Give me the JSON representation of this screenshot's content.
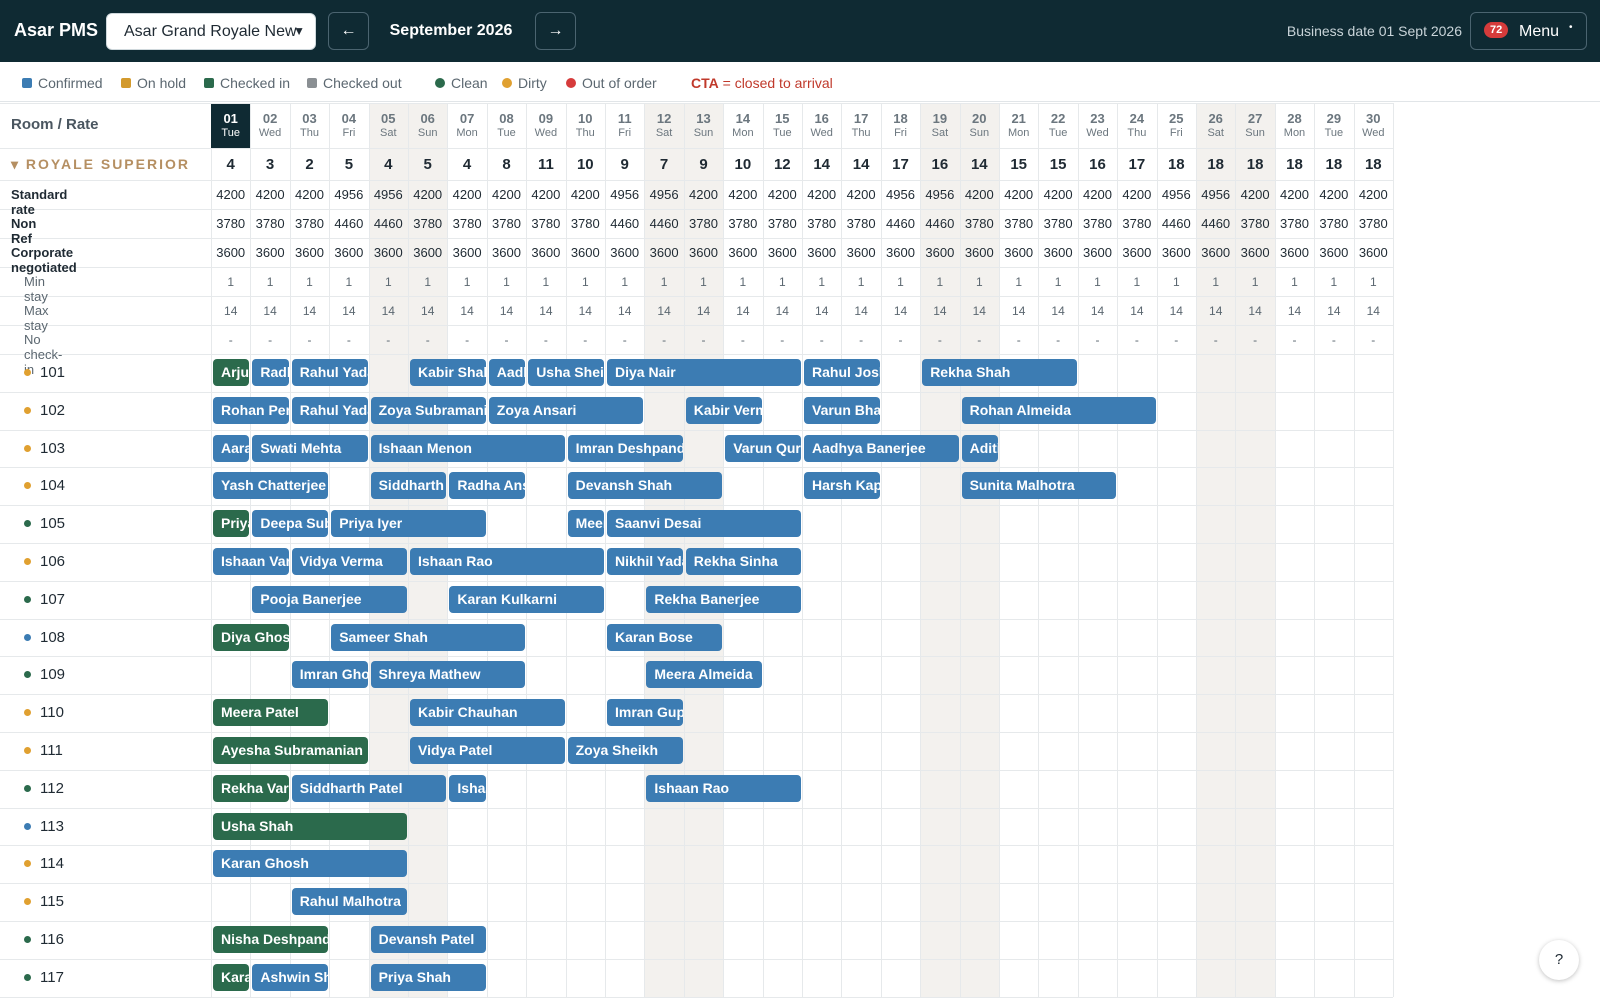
{
  "topbar": {
    "brand": "Asar PMS",
    "property": "Asar Grand Royale New",
    "prev_icon": "arrow-left-icon",
    "next_icon": "arrow-right-icon",
    "month": "September 2026",
    "business_date": "Business date 01 Sept 2026",
    "menu_badge": "72",
    "menu_label": "Menu"
  },
  "colors": {
    "topbar": "#0f2a33",
    "confirmed": "#3c7cb3",
    "on_hold": "#d39a2d",
    "checked_in": "#2b6a4c",
    "checked_out": "#8a8f93",
    "clean": "#2b6a4c",
    "dirty": "#e0a030",
    "out_of_order": "#d63b3b",
    "section": "#b58f62"
  },
  "legend": {
    "confirmed": "Confirmed",
    "on_hold": "On hold",
    "checked_in": "Checked in",
    "checked_out": "Checked out",
    "clean": "Clean",
    "dirty": "Dirty",
    "out_of_order": "Out of order",
    "cta_code": "CTA",
    "cta_text": " = closed to arrival"
  },
  "grid": {
    "room_rate_header": "Room / Rate",
    "section_title": "▾ ROYALE SUPERIOR",
    "days": [
      {
        "d": "01",
        "w": "Tue"
      },
      {
        "d": "02",
        "w": "Wed"
      },
      {
        "d": "03",
        "w": "Thu"
      },
      {
        "d": "04",
        "w": "Fri"
      },
      {
        "d": "05",
        "w": "Sat"
      },
      {
        "d": "06",
        "w": "Sun"
      },
      {
        "d": "07",
        "w": "Mon"
      },
      {
        "d": "08",
        "w": "Tue"
      },
      {
        "d": "09",
        "w": "Wed"
      },
      {
        "d": "10",
        "w": "Thu"
      },
      {
        "d": "11",
        "w": "Fri"
      },
      {
        "d": "12",
        "w": "Sat"
      },
      {
        "d": "13",
        "w": "Sun"
      },
      {
        "d": "14",
        "w": "Mon"
      },
      {
        "d": "15",
        "w": "Tue"
      },
      {
        "d": "16",
        "w": "Wed"
      },
      {
        "d": "17",
        "w": "Thu"
      },
      {
        "d": "18",
        "w": "Fri"
      },
      {
        "d": "19",
        "w": "Sat"
      },
      {
        "d": "20",
        "w": "Sun"
      },
      {
        "d": "21",
        "w": "Mon"
      },
      {
        "d": "22",
        "w": "Tue"
      },
      {
        "d": "23",
        "w": "Wed"
      },
      {
        "d": "24",
        "w": "Thu"
      },
      {
        "d": "25",
        "w": "Fri"
      },
      {
        "d": "26",
        "w": "Sat"
      },
      {
        "d": "27",
        "w": "Sun"
      },
      {
        "d": "28",
        "w": "Mon"
      },
      {
        "d": "29",
        "w": "Tue"
      },
      {
        "d": "30",
        "w": "Wed"
      }
    ],
    "availability": [
      4,
      3,
      2,
      5,
      4,
      5,
      4,
      8,
      11,
      10,
      9,
      7,
      9,
      10,
      12,
      14,
      14,
      17,
      16,
      14,
      15,
      15,
      16,
      17,
      18,
      18,
      18,
      18,
      18,
      18
    ],
    "rates": [
      {
        "label": "Standard rate",
        "values": [
          "4200",
          "4200",
          "4200",
          "4956",
          "4956",
          "4200",
          "4200",
          "4200",
          "4200",
          "4200",
          "4956",
          "4956",
          "4200",
          "4200",
          "4200",
          "4200",
          "4200",
          "4956",
          "4956",
          "4200",
          "4200",
          "4200",
          "4200",
          "4200",
          "4956",
          "4956",
          "4200",
          "4200",
          "4200",
          "4200"
        ]
      },
      {
        "label": "Non Ref",
        "values": [
          "3780",
          "3780",
          "3780",
          "4460",
          "4460",
          "3780",
          "3780",
          "3780",
          "3780",
          "3780",
          "4460",
          "4460",
          "3780",
          "3780",
          "3780",
          "3780",
          "3780",
          "4460",
          "4460",
          "3780",
          "3780",
          "3780",
          "3780",
          "3780",
          "4460",
          "4460",
          "3780",
          "3780",
          "3780",
          "3780"
        ]
      },
      {
        "label": "Corporate negotiated",
        "values": [
          "3600",
          "3600",
          "3600",
          "3600",
          "3600",
          "3600",
          "3600",
          "3600",
          "3600",
          "3600",
          "3600",
          "3600",
          "3600",
          "3600",
          "3600",
          "3600",
          "3600",
          "3600",
          "3600",
          "3600",
          "3600",
          "3600",
          "3600",
          "3600",
          "3600",
          "3600",
          "3600",
          "3600",
          "3600",
          "3600"
        ]
      }
    ],
    "restrictions": [
      {
        "label": "Min stay",
        "value": "1"
      },
      {
        "label": "Max stay",
        "value": "14"
      },
      {
        "label": "No check-in",
        "value": "-"
      }
    ],
    "rooms": [
      {
        "no": "101",
        "status": "dirty",
        "bookings": [
          {
            "n": "Arjun",
            "s": 0,
            "e": 1,
            "t": "cin"
          },
          {
            "n": "Radha",
            "s": 1,
            "e": 2,
            "t": "conf"
          },
          {
            "n": "Rahul Yadav",
            "s": 2,
            "e": 4,
            "t": "conf"
          },
          {
            "n": "Kabir Shah",
            "s": 5,
            "e": 7,
            "t": "conf"
          },
          {
            "n": "Aadhya",
            "s": 7,
            "e": 8,
            "t": "conf"
          },
          {
            "n": "Usha Sheikh",
            "s": 8,
            "e": 10,
            "t": "conf"
          },
          {
            "n": "Diya Nair",
            "s": 10,
            "e": 15,
            "t": "conf"
          },
          {
            "n": "Rahul Joshi",
            "s": 15,
            "e": 17,
            "t": "conf"
          },
          {
            "n": "Rekha Shah",
            "s": 18,
            "e": 22,
            "t": "conf"
          }
        ]
      },
      {
        "no": "102",
        "status": "dirty",
        "bookings": [
          {
            "n": "Rohan Pereira",
            "s": 0,
            "e": 2,
            "t": "conf"
          },
          {
            "n": "Rahul Yadav",
            "s": 2,
            "e": 4,
            "t": "conf"
          },
          {
            "n": "Zoya Subramanian",
            "s": 4,
            "e": 7,
            "t": "conf"
          },
          {
            "n": "Zoya Ansari",
            "s": 7,
            "e": 11,
            "t": "conf"
          },
          {
            "n": "Kabir Verma",
            "s": 12,
            "e": 14,
            "t": "conf"
          },
          {
            "n": "Varun Bhatt",
            "s": 15,
            "e": 17,
            "t": "conf"
          },
          {
            "n": "Rohan Almeida",
            "s": 19,
            "e": 24,
            "t": "conf"
          }
        ]
      },
      {
        "no": "103",
        "status": "dirty",
        "bookings": [
          {
            "n": "Aarav",
            "s": 0,
            "e": 1,
            "t": "conf"
          },
          {
            "n": "Swati Mehta",
            "s": 1,
            "e": 4,
            "t": "conf"
          },
          {
            "n": "Ishaan Menon",
            "s": 4,
            "e": 9,
            "t": "conf"
          },
          {
            "n": "Imran Deshpande",
            "s": 9,
            "e": 12,
            "t": "conf"
          },
          {
            "n": "Varun Qureshi",
            "s": 13,
            "e": 15,
            "t": "conf"
          },
          {
            "n": "Aadhya Banerjee",
            "s": 15,
            "e": 19,
            "t": "conf"
          },
          {
            "n": "Aditi",
            "s": 19,
            "e": 20,
            "t": "conf"
          }
        ]
      },
      {
        "no": "104",
        "status": "dirty",
        "bookings": [
          {
            "n": "Yash Chatterjee",
            "s": 0,
            "e": 3,
            "t": "conf"
          },
          {
            "n": "Siddharth",
            "s": 4,
            "e": 6,
            "t": "conf"
          },
          {
            "n": "Radha Ansari",
            "s": 6,
            "e": 8,
            "t": "conf"
          },
          {
            "n": "Devansh Shah",
            "s": 9,
            "e": 13,
            "t": "conf"
          },
          {
            "n": "Harsh Kapoor",
            "s": 15,
            "e": 17,
            "t": "conf"
          },
          {
            "n": "Sunita Malhotra",
            "s": 19,
            "e": 23,
            "t": "conf"
          }
        ]
      },
      {
        "no": "105",
        "status": "clean",
        "bookings": [
          {
            "n": "Priya",
            "s": 0,
            "e": 1,
            "t": "cin"
          },
          {
            "n": "Deepa Subramanian",
            "s": 1,
            "e": 3,
            "t": "conf"
          },
          {
            "n": "Priya Iyer",
            "s": 3,
            "e": 7,
            "t": "conf"
          },
          {
            "n": "Meera",
            "s": 9,
            "e": 10,
            "t": "conf"
          },
          {
            "n": "Saanvi Desai",
            "s": 10,
            "e": 15,
            "t": "conf"
          }
        ]
      },
      {
        "no": "106",
        "status": "dirty",
        "bookings": [
          {
            "n": "Ishaan Varma",
            "s": 0,
            "e": 2,
            "t": "conf"
          },
          {
            "n": "Vidya Verma",
            "s": 2,
            "e": 5,
            "t": "conf"
          },
          {
            "n": "Ishaan Rao",
            "s": 5,
            "e": 10,
            "t": "conf"
          },
          {
            "n": "Nikhil Yadav",
            "s": 10,
            "e": 12,
            "t": "conf"
          },
          {
            "n": "Rekha Sinha",
            "s": 12,
            "e": 15,
            "t": "conf"
          }
        ]
      },
      {
        "no": "107",
        "status": "clean",
        "bookings": [
          {
            "n": "Pooja Banerjee",
            "s": 1,
            "e": 5,
            "t": "conf"
          },
          {
            "n": "Karan Kulkarni",
            "s": 6,
            "e": 10,
            "t": "conf"
          },
          {
            "n": "Rekha Banerjee",
            "s": 11,
            "e": 15,
            "t": "conf"
          }
        ]
      },
      {
        "no": "108",
        "status": "confirmed",
        "bookings": [
          {
            "n": "Diya Ghosh",
            "s": 0,
            "e": 2,
            "t": "cin"
          },
          {
            "n": "Sameer Shah",
            "s": 3,
            "e": 8,
            "t": "conf"
          },
          {
            "n": "Karan Bose",
            "s": 10,
            "e": 13,
            "t": "conf"
          }
        ]
      },
      {
        "no": "109",
        "status": "clean",
        "bookings": [
          {
            "n": "Imran Ghosh",
            "s": 2,
            "e": 4,
            "t": "conf"
          },
          {
            "n": "Shreya Mathew",
            "s": 4,
            "e": 8,
            "t": "conf"
          },
          {
            "n": "Meera Almeida",
            "s": 11,
            "e": 14,
            "t": "conf"
          }
        ]
      },
      {
        "no": "110",
        "status": "dirty",
        "bookings": [
          {
            "n": "Meera Patel",
            "s": 0,
            "e": 3,
            "t": "cin"
          },
          {
            "n": "Kabir Chauhan",
            "s": 5,
            "e": 9,
            "t": "conf"
          },
          {
            "n": "Imran Gupta",
            "s": 10,
            "e": 12,
            "t": "conf"
          }
        ]
      },
      {
        "no": "111",
        "status": "dirty",
        "bookings": [
          {
            "n": "Ayesha Subramanian",
            "s": 0,
            "e": 4,
            "t": "cin"
          },
          {
            "n": "Vidya Patel",
            "s": 5,
            "e": 9,
            "t": "conf"
          },
          {
            "n": "Zoya Sheikh",
            "s": 9,
            "e": 12,
            "t": "conf"
          }
        ]
      },
      {
        "no": "112",
        "status": "clean",
        "bookings": [
          {
            "n": "Rekha Varma",
            "s": 0,
            "e": 2,
            "t": "cin"
          },
          {
            "n": "Siddharth Patel",
            "s": 2,
            "e": 6,
            "t": "conf"
          },
          {
            "n": "Ishaan",
            "s": 6,
            "e": 7,
            "t": "conf"
          },
          {
            "n": "Ishaan Rao",
            "s": 11,
            "e": 15,
            "t": "conf"
          }
        ]
      },
      {
        "no": "113",
        "status": "confirmed",
        "bookings": [
          {
            "n": "Usha Shah",
            "s": 0,
            "e": 5,
            "t": "cin"
          }
        ]
      },
      {
        "no": "114",
        "status": "dirty",
        "bookings": [
          {
            "n": "Karan Ghosh",
            "s": 0,
            "e": 5,
            "t": "conf"
          }
        ]
      },
      {
        "no": "115",
        "status": "dirty",
        "bookings": [
          {
            "n": "Rahul Malhotra",
            "s": 2,
            "e": 5,
            "t": "conf"
          }
        ]
      },
      {
        "no": "116",
        "status": "clean",
        "bookings": [
          {
            "n": "Nisha Deshpande",
            "s": 0,
            "e": 3,
            "t": "cin"
          },
          {
            "n": "Devansh Patel",
            "s": 4,
            "e": 7,
            "t": "conf"
          }
        ]
      },
      {
        "no": "117",
        "status": "clean",
        "bookings": [
          {
            "n": "Karan",
            "s": 0,
            "e": 1,
            "t": "cin"
          },
          {
            "n": "Ashwin Shah",
            "s": 1,
            "e": 3,
            "t": "conf"
          },
          {
            "n": "Priya Shah",
            "s": 4,
            "e": 7,
            "t": "conf"
          }
        ]
      }
    ]
  },
  "help": "?"
}
